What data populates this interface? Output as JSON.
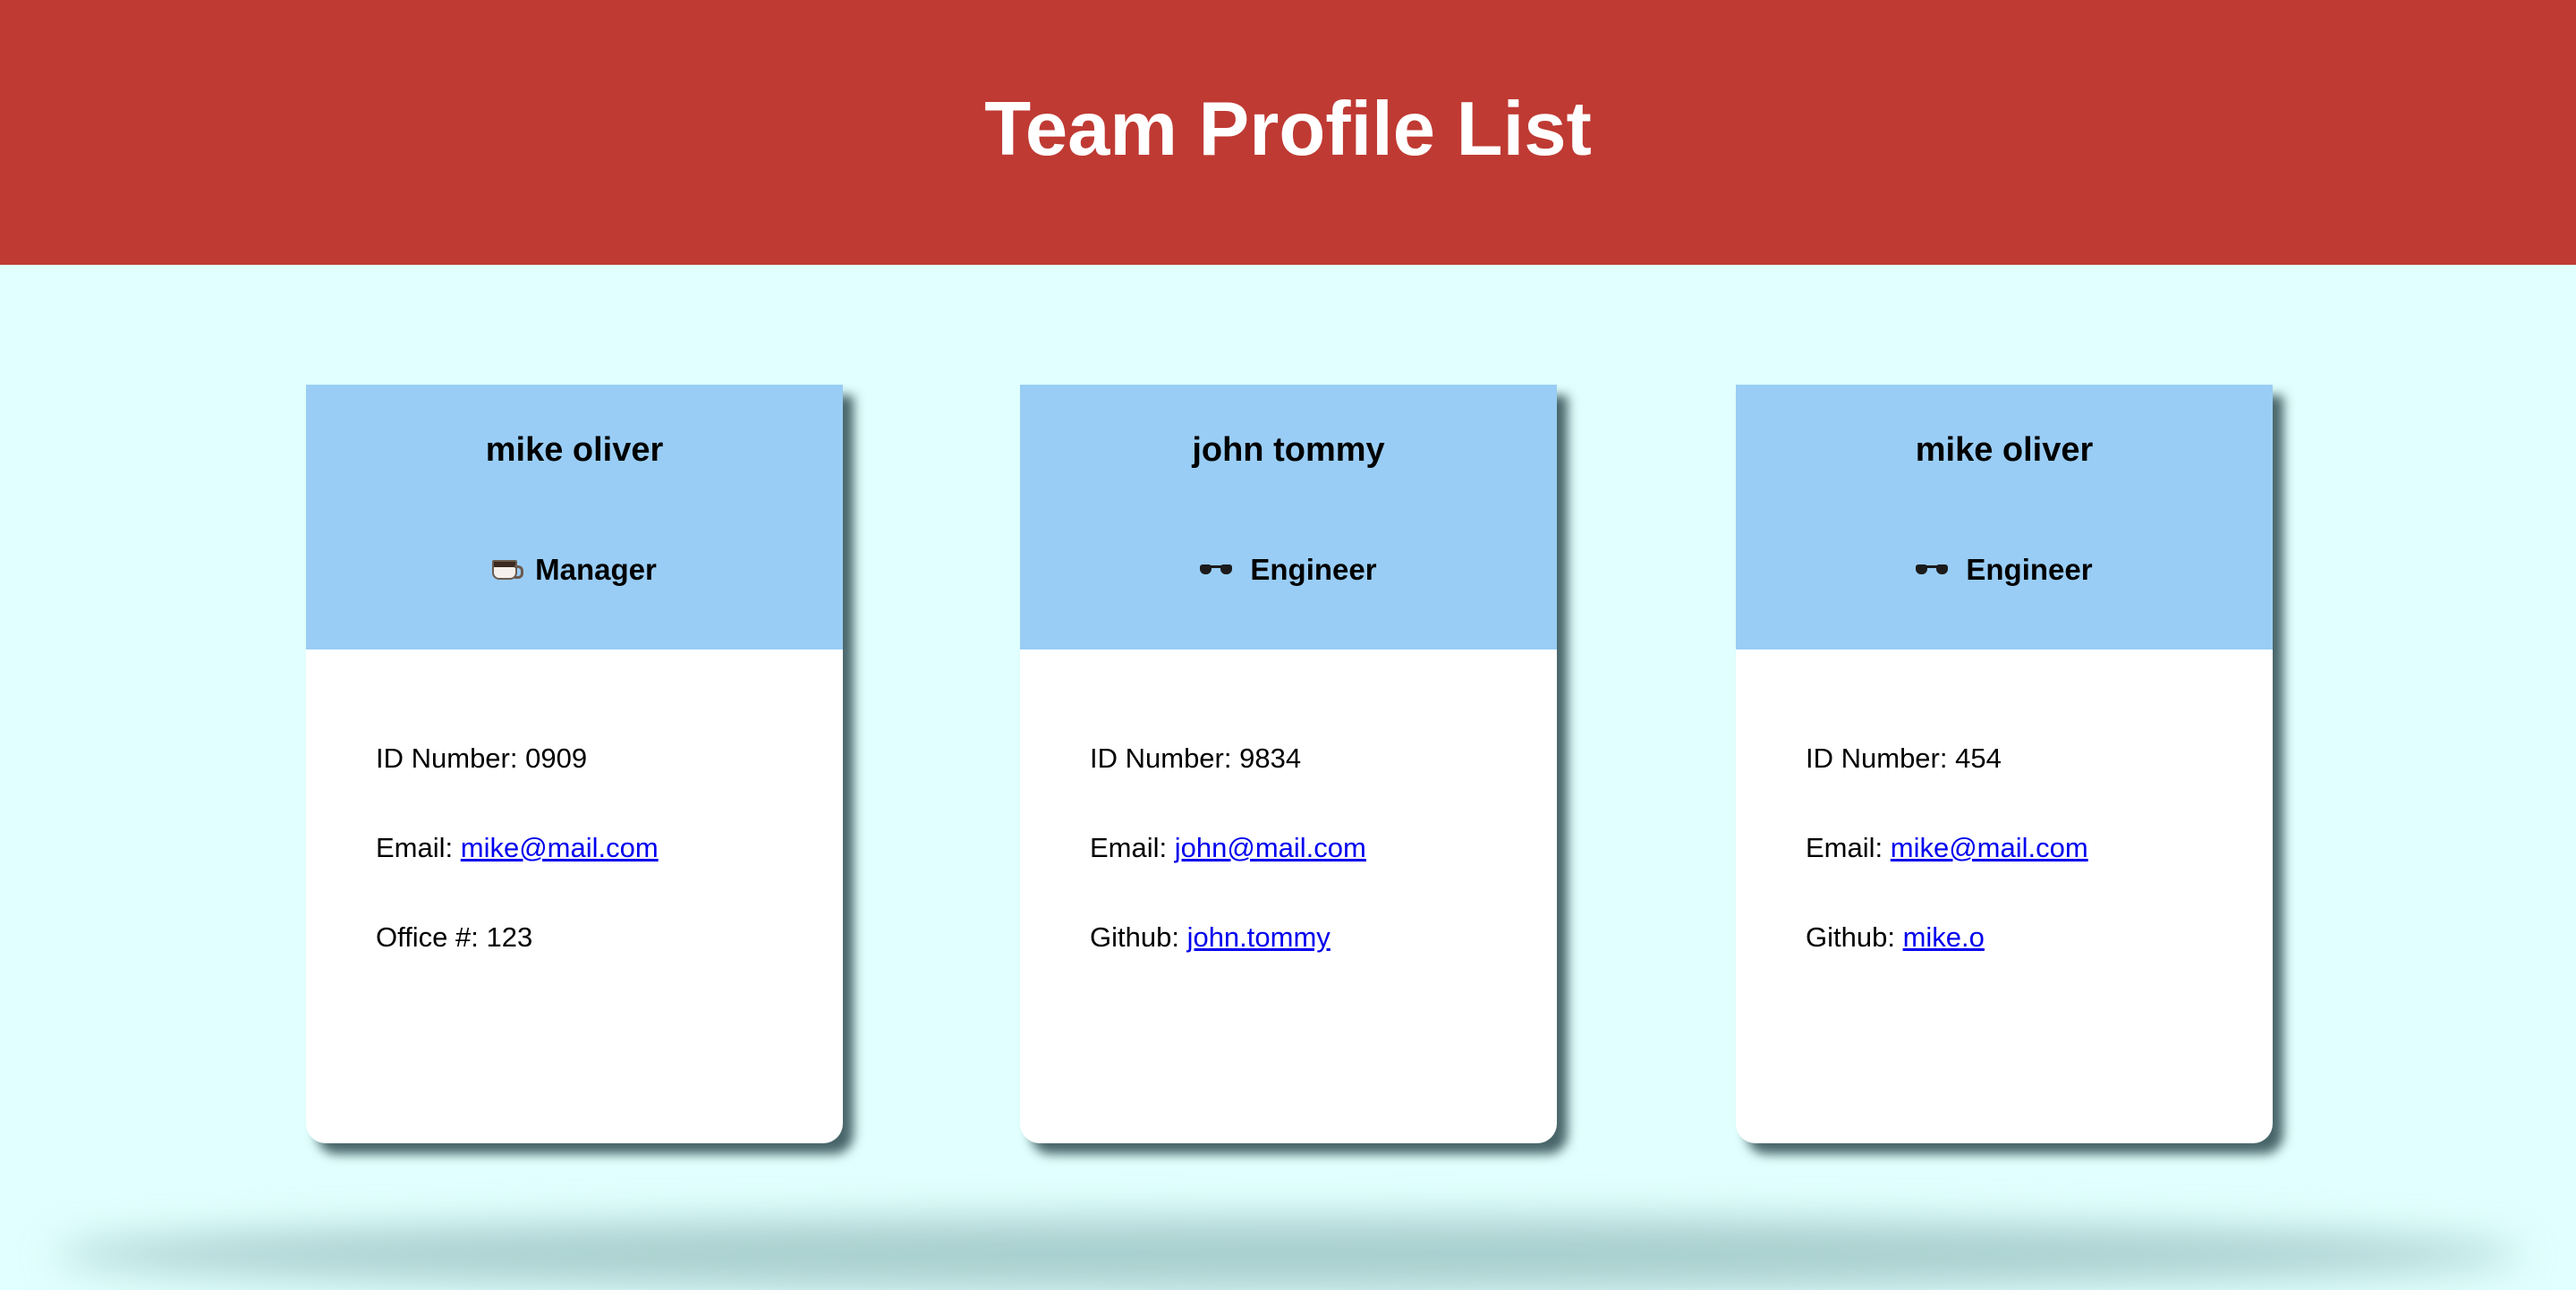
{
  "header": {
    "title": "Team Profile List"
  },
  "colors": {
    "header_bg": "#bf3a33",
    "page_bg": "#e1fffe",
    "card_header_bg": "#99cdf5",
    "link": "#0000ee"
  },
  "cards": [
    {
      "name": "mike oliver",
      "role": "Manager",
      "role_icon": "coffee-icon",
      "id_label": "ID Number: ",
      "id": "0909",
      "email_label": "Email: ",
      "email": "mike@mail.com",
      "extra_label": "Office #: ",
      "extra_value": "123"
    },
    {
      "name": "john tommy",
      "role": "Engineer",
      "role_icon": "glasses-icon",
      "id_label": "ID Number: ",
      "id": "9834",
      "email_label": "Email: ",
      "email": "john@mail.com",
      "extra_label": "Github: ",
      "extra_value": "john.tommy"
    },
    {
      "name": "mike oliver",
      "role": "Engineer",
      "role_icon": "glasses-icon",
      "id_label": "ID Number: ",
      "id": "454",
      "email_label": "Email: ",
      "email": "mike@mail.com",
      "extra_label": "Github: ",
      "extra_value": "mike.o"
    }
  ]
}
